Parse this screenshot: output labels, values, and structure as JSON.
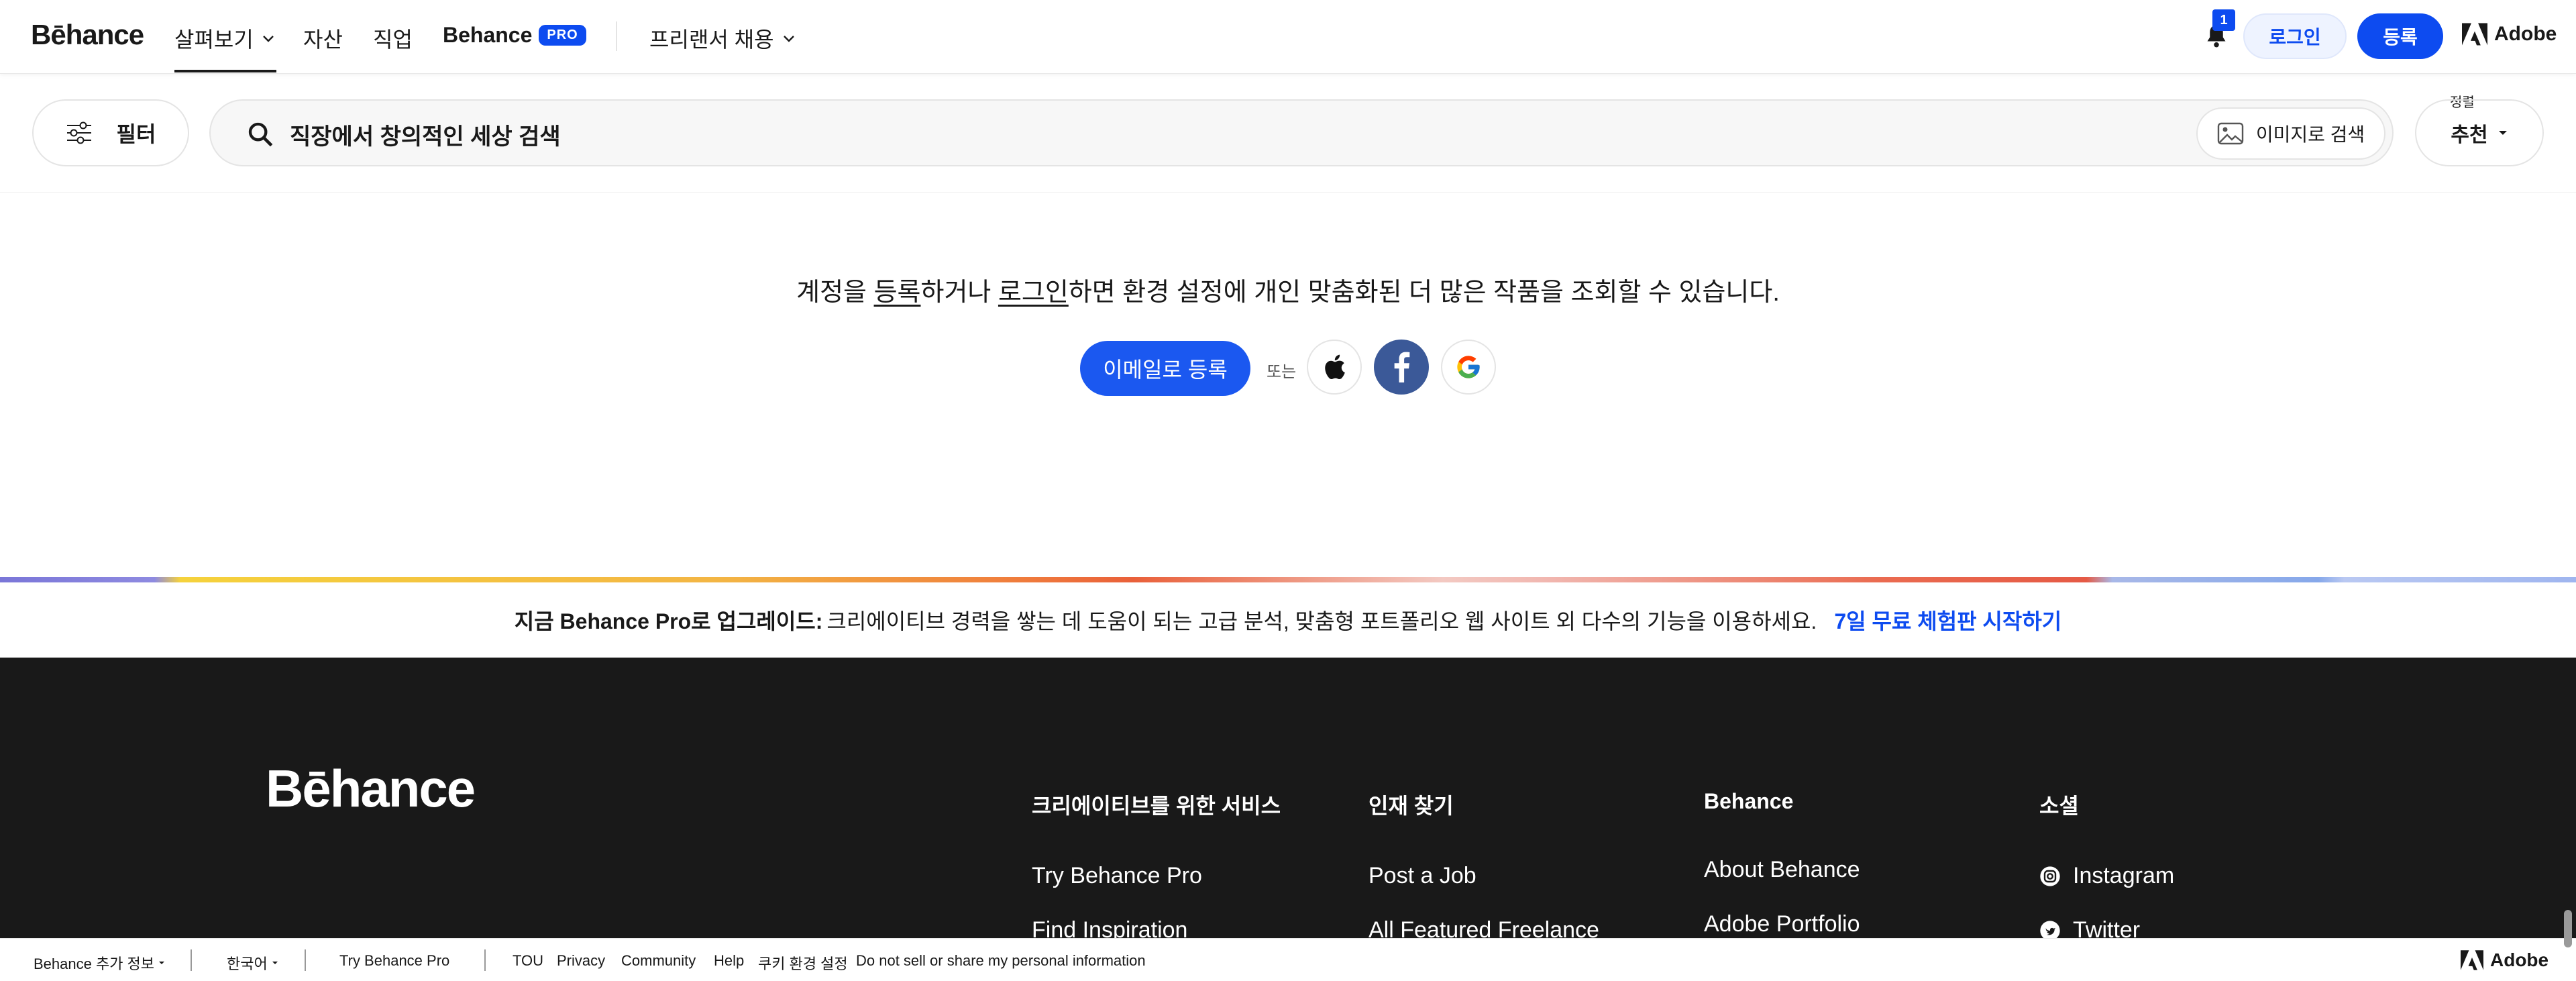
{
  "header": {
    "logo": "Bēhance",
    "nav": {
      "explore": "살펴보기",
      "assets": "자산",
      "jobs": "직업",
      "behance_pro": "Behance",
      "pro_badge": "PRO",
      "hire_freelancers": "프리랜서 채용"
    },
    "notification_count": "1",
    "login": "로그인",
    "signup": "등록",
    "adobe": "Adobe"
  },
  "search": {
    "filter_label": "필터",
    "query": "직장에서 창의적인 세상 검색",
    "image_search_label": "이미지로 검색",
    "sort_caption": "정렬",
    "sort_value": "추천"
  },
  "prompt": {
    "before": "계정을 ",
    "signup_link": "등록",
    "middle": "하거나 ",
    "login_link": "로그인",
    "after": "하면 환경 설정에 개인 맞춤화된 더 많은 작품을 조회할 수 있습니다.",
    "email_signup": "이메일로 등록",
    "or": "또는"
  },
  "pro_banner": {
    "strong": "지금 Behance Pro로 업그레이드:",
    "text": "크리에이티브 경력을 쌓는 데 도움이 되는 고급 분석, 맞춤형 포트폴리오 웹 사이트 외 다수의 기능을 이용하세요.",
    "cta": "7일 무료 체험판 시작하기",
    "gradient_colors": [
      "#7a76d8",
      "#f5d23c",
      "#e9603a",
      "#f3c9c2",
      "#e55a45",
      "#86a8ea"
    ]
  },
  "footer": {
    "logo": "Bēhance",
    "columns": [
      {
        "title": "크리에이티브를 위한 서비스",
        "links": [
          "Try Behance Pro",
          "Find Inspiration"
        ]
      },
      {
        "title": "인재 찾기",
        "links": [
          "Post a Job",
          "All Featured Freelance"
        ]
      },
      {
        "title": "Behance",
        "links": [
          "About Behance",
          "Adobe Portfolio"
        ]
      },
      {
        "title": "소셜",
        "links": [
          "Instagram",
          "Twitter"
        ]
      }
    ]
  },
  "bottombar": {
    "more_info": "Behance 추가 정보",
    "language": "한국어",
    "try_pro": "Try Behance Pro",
    "tou": "TOU",
    "privacy": "Privacy",
    "community": "Community",
    "help": "Help",
    "cookie": "쿠키 환경 설정",
    "do_not_sell": "Do not sell or share my personal information",
    "adobe": "Adobe"
  },
  "colors": {
    "accent": "#0d4bf0",
    "facebook": "#3b5998",
    "footer_bg": "#191919"
  }
}
